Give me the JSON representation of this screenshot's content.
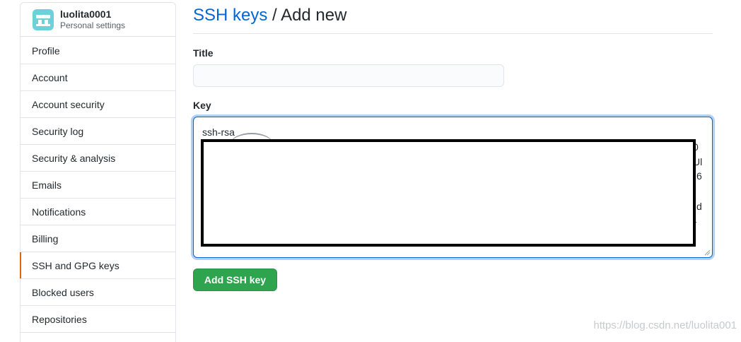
{
  "user": {
    "name": "luolita0001",
    "subtitle": "Personal settings"
  },
  "sidebar": {
    "items": [
      {
        "label": "Profile",
        "selected": false
      },
      {
        "label": "Account",
        "selected": false
      },
      {
        "label": "Account security",
        "selected": false
      },
      {
        "label": "Security log",
        "selected": false
      },
      {
        "label": "Security & analysis",
        "selected": false
      },
      {
        "label": "Emails",
        "selected": false
      },
      {
        "label": "Notifications",
        "selected": false
      },
      {
        "label": "Billing",
        "selected": false
      },
      {
        "label": "SSH and GPG keys",
        "selected": true
      },
      {
        "label": "Blocked users",
        "selected": false
      },
      {
        "label": "Repositories",
        "selected": false
      }
    ]
  },
  "header": {
    "link": "SSH keys",
    "separator": "/",
    "current": "Add new"
  },
  "form": {
    "title_label": "Title",
    "title_value": "",
    "key_label": "Key",
    "key_prefix": "ssh-rsa",
    "visible_fragments": [
      "0",
      "Ul",
      "6",
      "d",
      "L"
    ],
    "submit_label": "Add SSH key"
  },
  "watermark": "https://blog.csdn.net/luolita001",
  "colors": {
    "link": "#0366d6",
    "primary_button": "#2ea44f",
    "selected_indicator": "#e36209",
    "avatar": "#6cd1d8"
  }
}
